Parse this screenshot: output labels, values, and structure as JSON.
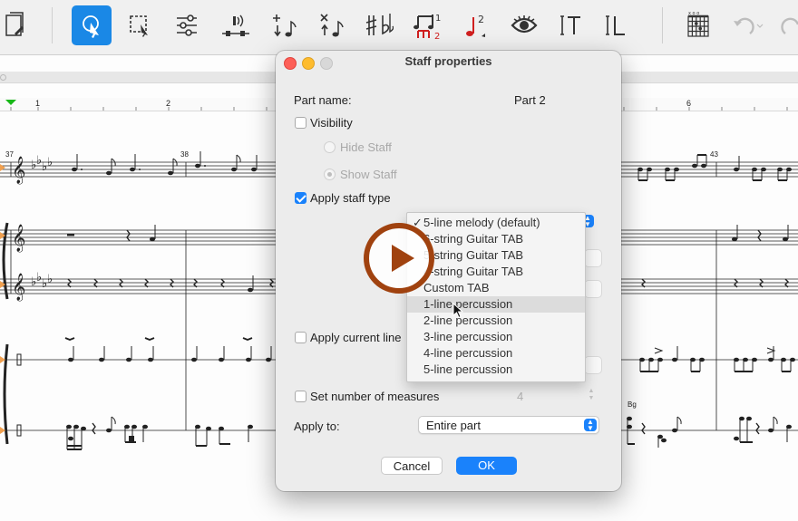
{
  "toolbar": {
    "icons": [
      "score-file-icon",
      "selection-arrow-icon",
      "box-select-icon",
      "mixer-sliders-icon",
      "audio-playback-icon",
      "add-note-icon",
      "remove-note-icon",
      "accidentals-icon",
      "tuplet-icon",
      "note-color-icon",
      "eye-icon",
      "text-tool-icon",
      "lyrics-tool-icon",
      "chord-diagram-icon",
      "undo-icon",
      "redo-icon"
    ],
    "accent": "#1a88e6"
  },
  "ruler": {
    "marks": [
      "1",
      "2",
      "6"
    ]
  },
  "score": {
    "measure_numbers": [
      "37",
      "38",
      "43"
    ],
    "chord_symbol": "Bg"
  },
  "dialog": {
    "title": "Staff properties",
    "part_name_label": "Part name:",
    "part_name_value": "Part 2",
    "visibility_label": "Visibility",
    "visibility_checked": false,
    "hide_staff_label": "Hide Staff",
    "show_staff_label": "Show Staff",
    "apply_staff_type_label": "Apply staff type",
    "apply_staff_type_checked": true,
    "apply_current_label": "Apply current line",
    "set_measures_label": "Set number of measures",
    "measures_value": "4",
    "apply_to_label": "Apply to:",
    "apply_to_value": "Entire part",
    "cancel_label": "Cancel",
    "ok_label": "OK",
    "accent": "#1a82fb"
  },
  "dropdown": {
    "selected_index": 0,
    "highlighted_index": 5,
    "checkmark": "✓",
    "items": [
      "5-line melody (default)",
      "6-string Guitar TAB",
      "5-string Guitar TAB",
      "4-string Guitar TAB",
      "Custom TAB",
      "1-line percussion",
      "2-line percussion",
      "3-line percussion",
      "4-line percussion",
      "5-line percussion"
    ]
  },
  "overlay": {
    "play_color": "#a0420f"
  }
}
